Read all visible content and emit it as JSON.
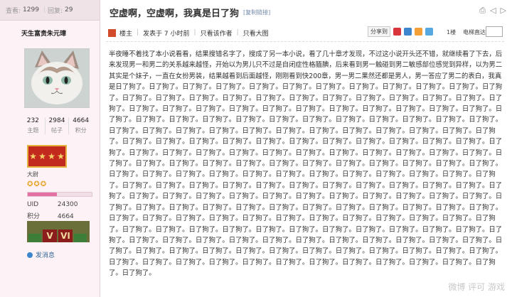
{
  "left_panel": {
    "views_label": "查看:",
    "views_value": "1299",
    "replies_label": "回复:",
    "replies_value": "29",
    "username": "天生富贵朱元璋",
    "counts": [
      {
        "value": "232",
        "label": "主题"
      },
      {
        "value": "2984",
        "label": "帖子"
      },
      {
        "value": "4664",
        "label": "积分"
      }
    ],
    "rank_title": "大尉",
    "rank_progress_fraction": 0.45,
    "uid_label": "UID",
    "uid_value": "24300",
    "points_label": "积分",
    "points_value": "4664",
    "medal_labels": [
      "V",
      "VI"
    ],
    "pm_label": "发消息"
  },
  "post": {
    "title": "空虚啊，空虚啊，我真是日了狗",
    "copy_link": "[复制链接]",
    "op_label": "楼主",
    "posted_at": "发表于 7 小时前",
    "author_only": "只看该作者",
    "large_image": "只看大图",
    "share_label": "分享到",
    "floor": "1楼",
    "jump_label": "电梯直达",
    "intro": "半夜睡不着找了本小说看看，结果搜错名字了，搜成了另一本小说，看了几十章才发现，不过这小说开头还不错，就继续看了下去，后来发现男一和男二的关系越来越怪，开始以为男儿只不过是自闭症性格腼腆，后来看到男一触碰到男二敏感部位感觉到异样，以为男二其实是个妹子，一直在女扮男装，结果越看到后面越怪，刚刚看到快200章，男一男二果然还都是男人，男一答应了男二的表白，我真是日了狗了。",
    "repeat_phrase": "日了狗了。",
    "watermark": "微博 评可 游戏"
  },
  "colors": {
    "left_bg": "#fdf3f6",
    "rank_red": "#c22a1e",
    "progress_pink": "#e371a3"
  }
}
